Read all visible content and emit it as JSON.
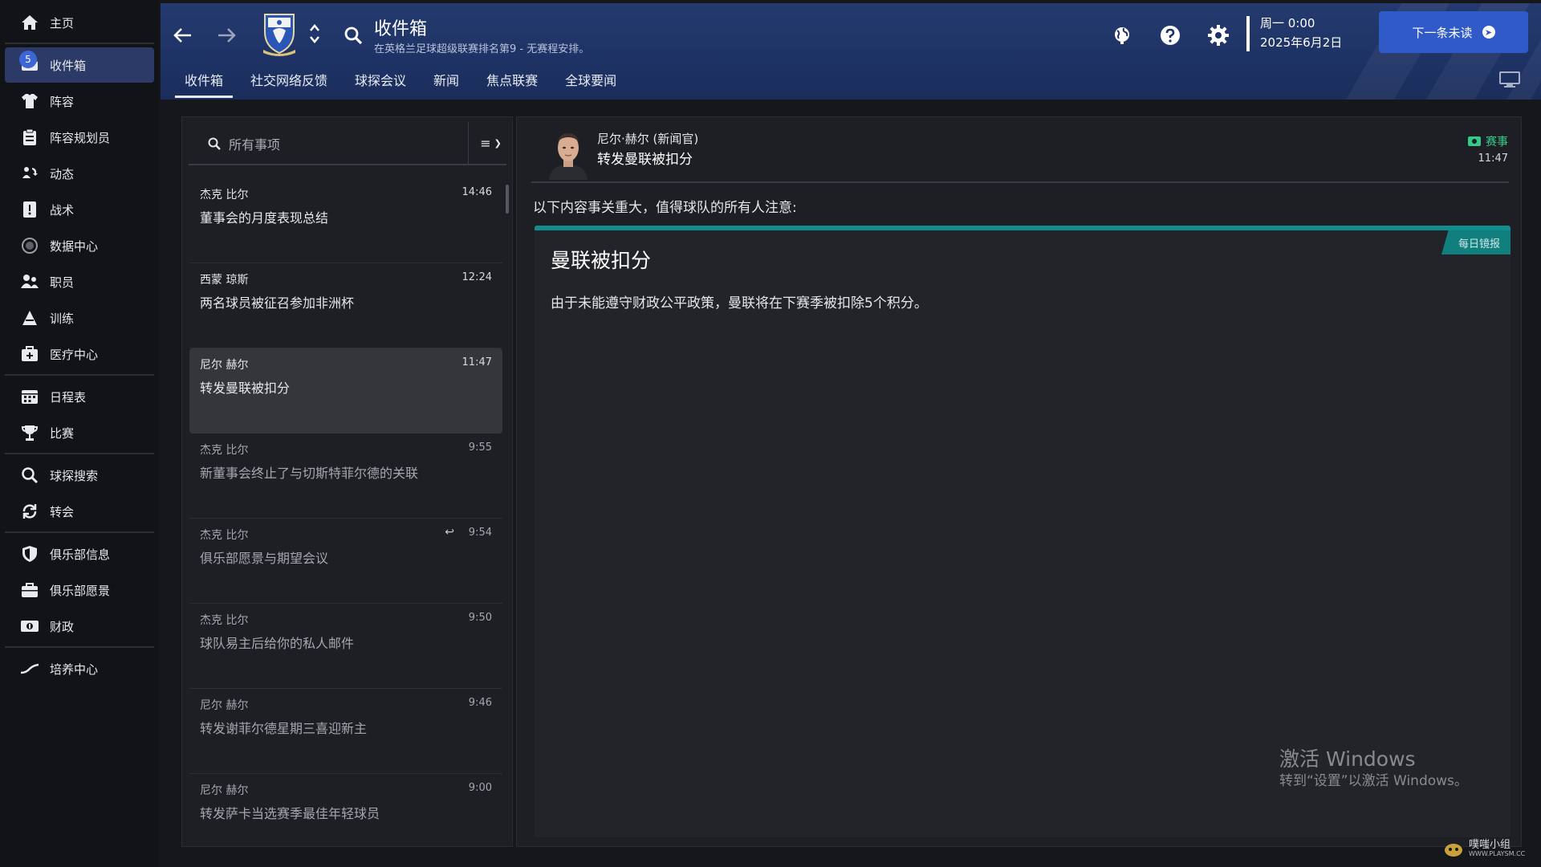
{
  "sidebar": {
    "items": [
      {
        "label": "主页",
        "icon": "home-icon"
      },
      {
        "label": "收件箱",
        "icon": "inbox-icon",
        "badge": "5",
        "active": true
      },
      {
        "label": "阵容",
        "icon": "jersey-icon"
      },
      {
        "label": "阵容规划员",
        "icon": "clipboard-icon"
      },
      {
        "label": "动态",
        "icon": "dynamics-icon"
      },
      {
        "label": "战术",
        "icon": "tactics-icon"
      },
      {
        "label": "数据中心",
        "icon": "data-hub-icon"
      },
      {
        "label": "职员",
        "icon": "staff-icon"
      },
      {
        "label": "训练",
        "icon": "training-icon"
      },
      {
        "label": "医疗中心",
        "icon": "medical-icon"
      },
      {
        "label": "日程表",
        "icon": "calendar-icon"
      },
      {
        "label": "比赛",
        "icon": "trophy-icon"
      },
      {
        "label": "球探搜索",
        "icon": "scouting-search-icon"
      },
      {
        "label": "转会",
        "icon": "transfers-icon"
      },
      {
        "label": "俱乐部信息",
        "icon": "club-shield-icon"
      },
      {
        "label": "俱乐部愿景",
        "icon": "vision-icon"
      },
      {
        "label": "财政",
        "icon": "finance-icon"
      },
      {
        "label": "培养中心",
        "icon": "development-icon"
      }
    ]
  },
  "header": {
    "title": "收件箱",
    "subtitle": "在英格兰足球超级联赛排名第9 - 无赛程安排。",
    "tabs": [
      {
        "label": "收件箱",
        "active": true
      },
      {
        "label": "社交网络反馈"
      },
      {
        "label": "球探会议"
      },
      {
        "label": "新闻"
      },
      {
        "label": "焦点联赛"
      },
      {
        "label": "全球要闻"
      }
    ],
    "weekday_time": "周一 0:00",
    "date": "2025年6月2日",
    "next_unread_label": "下一条未读"
  },
  "list": {
    "search_placeholder": "所有事项",
    "messages": [
      {
        "sender": "杰克 比尔",
        "time": "14:46",
        "subject": "董事会的月度表现总结",
        "read": false
      },
      {
        "sender": "西蒙 琼斯",
        "time": "12:24",
        "subject": "两名球员被征召参加非洲杯",
        "read": false
      },
      {
        "sender": "尼尔 赫尔",
        "time": "11:47",
        "subject": "转发曼联被扣分",
        "read": false,
        "selected": true
      },
      {
        "sender": "杰克 比尔",
        "time": "9:55",
        "subject": "新董事会终止了与切斯特菲尔德的关联",
        "read": true
      },
      {
        "sender": "杰克 比尔",
        "time": "9:54",
        "subject": "俱乐部愿景与期望会议",
        "read": true,
        "replied": true
      },
      {
        "sender": "杰克 比尔",
        "time": "9:50",
        "subject": "球队易主后给你的私人邮件",
        "read": true
      },
      {
        "sender": "尼尔 赫尔",
        "time": "9:46",
        "subject": "转发谢菲尔德星期三喜迎新主",
        "read": true
      },
      {
        "sender": "尼尔 赫尔",
        "time": "9:00",
        "subject": "转发萨卡当选赛季最佳年轻球员",
        "read": true
      }
    ]
  },
  "reader": {
    "sender": "尼尔·赫尔 (新闻官)",
    "subject": "转发曼联被扣分",
    "tag": "赛事",
    "time": "11:47",
    "intro": "以下内容事关重大，值得球队的所有人注意:",
    "source": "每日镜报",
    "headline": "曼联被扣分",
    "body": "由于未能遵守财政公平政策，曼联将在下赛季被扣除5个积分。"
  },
  "watermark": {
    "title": "激活 Windows",
    "subtitle": "转到“设置”以激活 Windows。",
    "site_name": "噗嗤小组",
    "site_url": "WWW.PLAYSM.CC"
  },
  "colors": {
    "accent": "#2f5ac7",
    "header_bg": "#1d3163",
    "active_nav": "#2b3a66",
    "tag_green": "#35c98a",
    "source_teal": "#138c8c"
  }
}
